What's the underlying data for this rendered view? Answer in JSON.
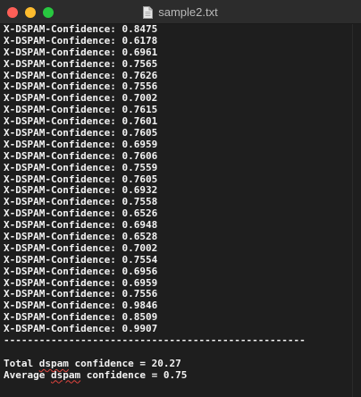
{
  "window": {
    "title": "sample2.txt",
    "icon": "text-document-icon"
  },
  "lines": [
    "X-DSPAM-Confidence: 0.8475",
    "X-DSPAM-Confidence: 0.6178",
    "X-DSPAM-Confidence: 0.6961",
    "X-DSPAM-Confidence: 0.7565",
    "X-DSPAM-Confidence: 0.7626",
    "X-DSPAM-Confidence: 0.7556",
    "X-DSPAM-Confidence: 0.7002",
    "X-DSPAM-Confidence: 0.7615",
    "X-DSPAM-Confidence: 0.7601",
    "X-DSPAM-Confidence: 0.7605",
    "X-DSPAM-Confidence: 0.6959",
    "X-DSPAM-Confidence: 0.7606",
    "X-DSPAM-Confidence: 0.7559",
    "X-DSPAM-Confidence: 0.7605",
    "X-DSPAM-Confidence: 0.6932",
    "X-DSPAM-Confidence: 0.7558",
    "X-DSPAM-Confidence: 0.6526",
    "X-DSPAM-Confidence: 0.6948",
    "X-DSPAM-Confidence: 0.6528",
    "X-DSPAM-Confidence: 0.7002",
    "X-DSPAM-Confidence: 0.7554",
    "X-DSPAM-Confidence: 0.6956",
    "X-DSPAM-Confidence: 0.6959",
    "X-DSPAM-Confidence: 0.7556",
    "X-DSPAM-Confidence: 0.9846",
    "X-DSPAM-Confidence: 0.8509",
    "X-DSPAM-Confidence: 0.9907"
  ],
  "divider": "---------------------------------------------------",
  "summary": {
    "total_prefix": "Total ",
    "total_word": "dspam",
    "total_suffix": " confidence = 20.27",
    "average_prefix": "Average ",
    "average_word": "dspam",
    "average_suffix": " confidence = 0.75"
  },
  "colors": {
    "background": "#1e1e1e",
    "text": "#f2f2f2",
    "titlebar": "#2c2c2c",
    "close": "#fe5f57",
    "minimize": "#febc2e",
    "maximize": "#28c840",
    "spellcheck": "#e0443e"
  }
}
